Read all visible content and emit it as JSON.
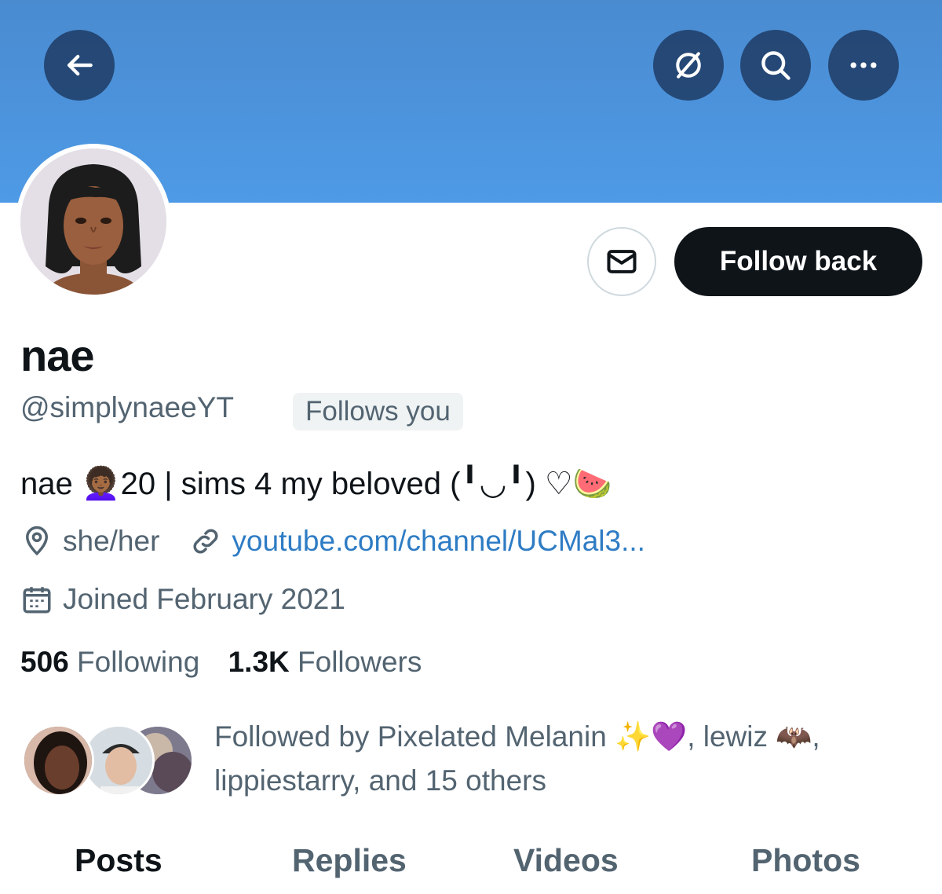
{
  "profile": {
    "display_name": "nae",
    "handle": "@simplynaeeYT",
    "follows_you": "Follows you",
    "bio": "nae 👩🏾‍🦱20 | sims 4 my beloved   (╹◡╹) ♡🍉",
    "location": "she/her",
    "website": "youtube.com/channel/UCMal3...",
    "joined": "Joined February 2021"
  },
  "actions": {
    "follow_back": "Follow back"
  },
  "stats": {
    "following_count": "506",
    "following_label": "Following",
    "followers_count": "1.3K",
    "followers_label": "Followers"
  },
  "followed_by": {
    "text": "Followed by Pixelated Melanin ✨💜, lewiz 🦇, lippiestarry, and 15 others"
  },
  "tabs": [
    {
      "label": "Posts",
      "active": true
    },
    {
      "label": "Replies",
      "active": false
    },
    {
      "label": "Videos",
      "active": false
    },
    {
      "label": "Photos",
      "active": false
    }
  ],
  "icons": {
    "back": "back-arrow-icon",
    "incognito": "slashed-circle-icon",
    "search": "search-icon",
    "more": "more-dots-icon",
    "message": "envelope-icon",
    "location": "location-pin-icon",
    "link": "link-icon",
    "calendar": "calendar-icon"
  },
  "colors": {
    "banner": "#4e9ae6",
    "accent_link": "#1d9bf0",
    "primary_button": "#0f1419",
    "secondary_text": "#536471"
  }
}
